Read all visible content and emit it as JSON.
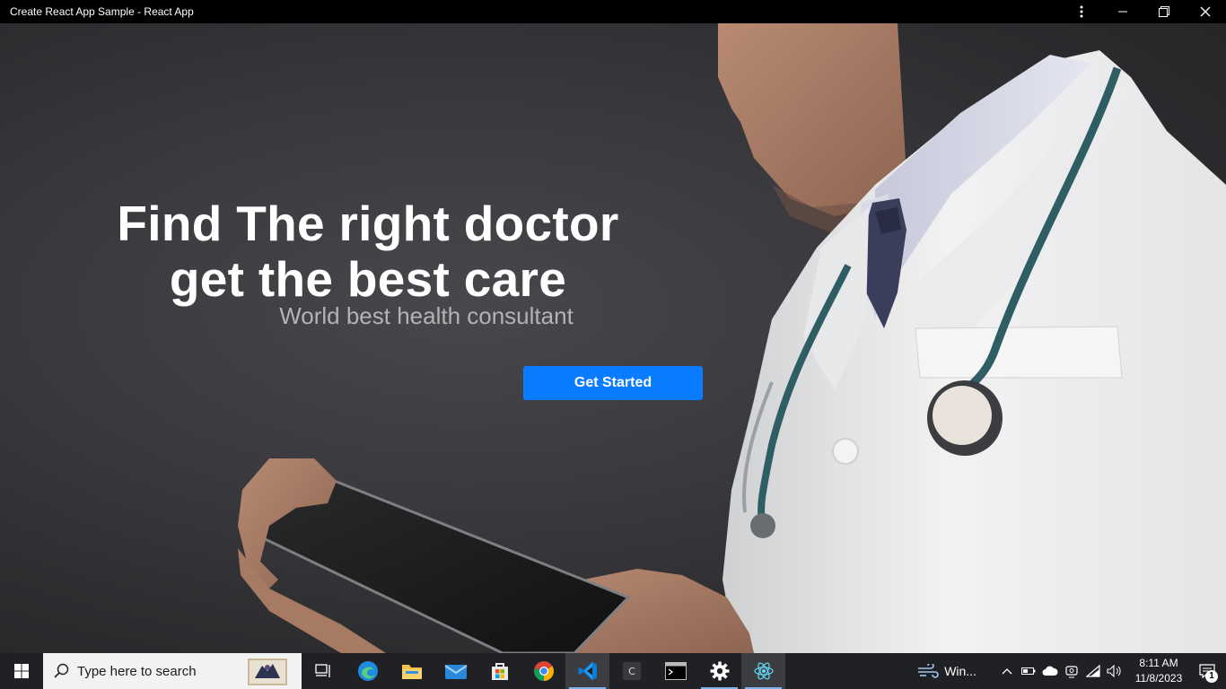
{
  "window": {
    "title": "Create React App Sample - React App",
    "controls": [
      "more-options",
      "minimize",
      "restore",
      "close"
    ]
  },
  "hero": {
    "headline_line1": "Find The right doctor",
    "headline_line2": "get the best care",
    "subheadline": "World best health consultant",
    "cta_label": "Get Started",
    "colors": {
      "cta": "#0a7cff",
      "headline": "#ffffff",
      "subheadline": "#b3b3b3"
    }
  },
  "taskbar": {
    "search_placeholder": "Type here to search",
    "apps": [
      {
        "name": "task-view-icon"
      },
      {
        "name": "edge-icon"
      },
      {
        "name": "file-explorer-icon"
      },
      {
        "name": "mail-icon"
      },
      {
        "name": "microsoft-store-icon"
      },
      {
        "name": "chrome-icon"
      },
      {
        "name": "vscode-icon"
      },
      {
        "name": "c-app-icon"
      },
      {
        "name": "terminal-icon"
      },
      {
        "name": "settings-icon"
      },
      {
        "name": "react-app-icon"
      }
    ],
    "weather_label": "Win...",
    "time": "8:11 AM",
    "date": "11/8/2023",
    "notification_count": "1"
  }
}
